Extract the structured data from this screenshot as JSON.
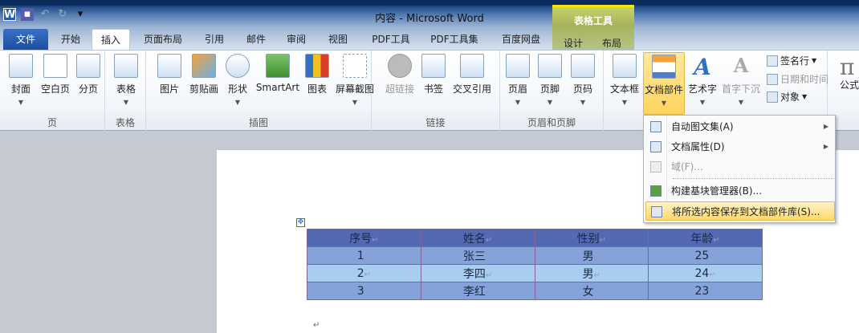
{
  "window": {
    "title": "内容 - Microsoft Word",
    "context_tab_group": "表格工具"
  },
  "tabs": [
    "文件",
    "开始",
    "插入",
    "页面布局",
    "引用",
    "邮件",
    "审阅",
    "视图",
    "PDF工具",
    "PDF工具集",
    "百度网盘",
    "设计",
    "布局"
  ],
  "ribbon": {
    "groups": [
      "页",
      "表格",
      "插图",
      "链接",
      "页眉和页脚"
    ],
    "buttons": [
      "封面",
      "空白页",
      "分页",
      "表格",
      "图片",
      "剪贴画",
      "形状",
      "SmartArt",
      "图表",
      "屏幕截图",
      "超链接",
      "书签",
      "交叉引用",
      "页眉",
      "页脚",
      "页码",
      "文本框",
      "文档部件",
      "艺术字",
      "首字下沉",
      "公式"
    ],
    "small": [
      "签名行",
      "日期和时间",
      "对象"
    ]
  },
  "menu": [
    "自动图文集(A)",
    "文档属性(D)",
    "域(F)...",
    "构建基块管理器(B)...",
    "将所选内容保存到文档部件库(S)..."
  ],
  "table": {
    "headers": [
      "序号",
      "姓名",
      "性别",
      "年龄"
    ],
    "rows": [
      [
        "1",
        "张三",
        "男",
        "25"
      ],
      [
        "2",
        "李四",
        "男",
        "24"
      ],
      [
        "3",
        "李红",
        "女",
        "23"
      ]
    ]
  },
  "mark": "↵"
}
